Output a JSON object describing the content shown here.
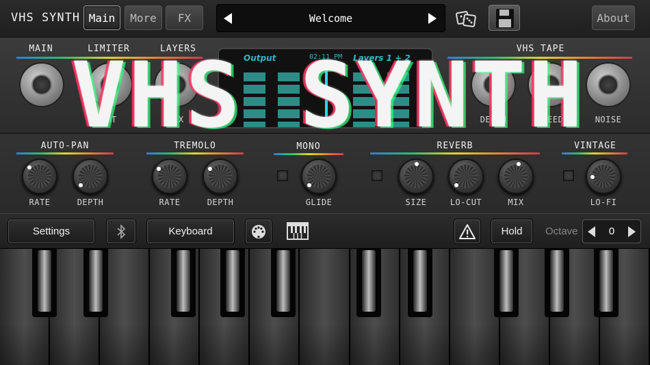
{
  "header": {
    "title": "VHS SYNTH",
    "tabs": [
      {
        "label": "Main",
        "active": true
      },
      {
        "label": "More",
        "active": false
      },
      {
        "label": "FX",
        "active": false
      }
    ],
    "preset_name": "Welcome",
    "about_label": "About"
  },
  "sections_top": {
    "main": "MAIN",
    "limiter": "LIMITER",
    "layers": "LAYERS",
    "vhs_tape": "VHS TAPE",
    "knob_labels": {
      "amt": "AMT",
      "mix": "MIX",
      "depth": "DEPTH",
      "speed": "SPEED",
      "noise": "NOISE"
    }
  },
  "display": {
    "output_label": "Output",
    "time": "02:11 PM",
    "layers_label": "Layers 1 + 2"
  },
  "sections_fx": {
    "autopan": {
      "title": "AUTO-PAN",
      "knobs": [
        "RATE",
        "DEPTH"
      ]
    },
    "tremolo": {
      "title": "TREMOLO",
      "knobs": [
        "RATE",
        "DEPTH"
      ]
    },
    "mono": {
      "title": "MONO",
      "knobs": [
        "GLIDE"
      ]
    },
    "reverb": {
      "title": "REVERB",
      "knobs": [
        "SIZE",
        "LO-CUT",
        "MIX"
      ]
    },
    "vintage": {
      "title": "VINTAGE",
      "knobs": [
        "LO-FI"
      ]
    }
  },
  "controls": {
    "settings": "Settings",
    "keyboard": "Keyboard",
    "hold": "Hold",
    "octave_label": "Octave",
    "octave_value": "0"
  },
  "logo_text": "VHS SYNTH",
  "colors": {
    "display_accent": "#2fb8c4",
    "meter": "#2e8c86",
    "background": "#2c2c2c"
  },
  "icons": [
    "dice-icon",
    "save-icon",
    "bluetooth-icon",
    "midi-icon",
    "piano-icon",
    "warning-icon"
  ]
}
